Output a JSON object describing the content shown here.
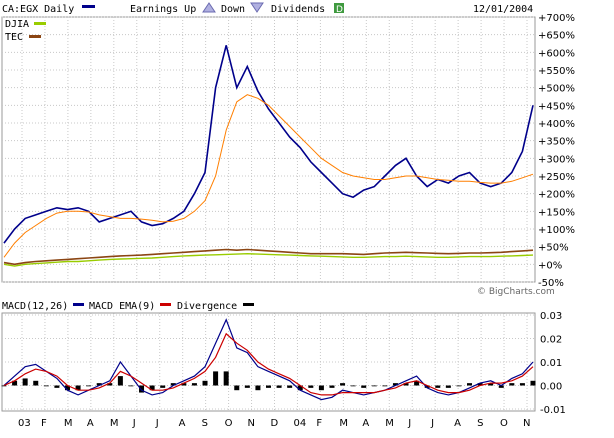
{
  "header": {
    "symbol": "CA:EGX Daily",
    "earnings_label": "Earnings Up",
    "down_label": "Down",
    "dividends_label": "Dividends",
    "dividends_marker": "D",
    "date": "12/01/2004"
  },
  "legend_price": [
    {
      "name": "DJIA",
      "color": "#99cc00"
    },
    {
      "name": "TEC",
      "color": "#8b4513"
    }
  ],
  "legend_macd": {
    "macd_label": "MACD(12,26)",
    "ema_label": "MACD EMA(9)",
    "div_label": "Divergence"
  },
  "watermark": "© BigCharts.com",
  "colors": {
    "price": "#00008b",
    "ma": "#ff7f00",
    "djia": "#99cc00",
    "tec": "#8b4513",
    "macd": "#00008b",
    "ema": "#cc0000",
    "divergence": "#000000"
  },
  "chart_data": [
    {
      "type": "line",
      "panel": "price",
      "yscale": "percent",
      "ylim": [
        -50,
        700
      ],
      "yticks": [
        "+700%",
        "+650%",
        "+600%",
        "+550%",
        "+500%",
        "+450%",
        "+400%",
        "+350%",
        "+300%",
        "+250%",
        "+200%",
        "+150%",
        "+100%",
        "+50%",
        "+0%",
        "-50%"
      ],
      "x": [
        0,
        2,
        4,
        6,
        8,
        10,
        12,
        14,
        16,
        18,
        20,
        22,
        24,
        26,
        28,
        30,
        32,
        34,
        36,
        38,
        40,
        42,
        44,
        46,
        48,
        50,
        52,
        54,
        56,
        58,
        60,
        62,
        64,
        66,
        68,
        70,
        72,
        74,
        76,
        78,
        80,
        82,
        84,
        86,
        88,
        90,
        92,
        94,
        96,
        98,
        100
      ],
      "series": [
        {
          "name": "CA:EGX",
          "values": [
            60,
            100,
            130,
            140,
            150,
            160,
            155,
            160,
            150,
            120,
            130,
            140,
            150,
            120,
            110,
            115,
            130,
            150,
            200,
            260,
            500,
            620,
            500,
            560,
            490,
            440,
            400,
            360,
            330,
            290,
            260,
            230,
            200,
            190,
            210,
            220,
            250,
            280,
            300,
            250,
            220,
            240,
            230,
            250,
            260,
            230,
            220,
            230,
            260,
            320,
            450
          ]
        },
        {
          "name": "MA",
          "values": [
            20,
            60,
            90,
            110,
            130,
            145,
            150,
            150,
            148,
            140,
            135,
            130,
            130,
            128,
            125,
            120,
            122,
            130,
            150,
            180,
            250,
            380,
            460,
            480,
            470,
            450,
            420,
            390,
            360,
            330,
            300,
            280,
            260,
            250,
            245,
            240,
            240,
            245,
            250,
            250,
            245,
            240,
            238,
            235,
            235,
            232,
            230,
            230,
            235,
            245,
            255
          ]
        },
        {
          "name": "DJIA",
          "values": [
            0,
            -5,
            0,
            2,
            4,
            6,
            8,
            8,
            10,
            12,
            14,
            15,
            16,
            17,
            18,
            20,
            22,
            24,
            25,
            26,
            27,
            28,
            29,
            30,
            29,
            28,
            27,
            26,
            25,
            24,
            23,
            22,
            21,
            20,
            20,
            21,
            22,
            22,
            23,
            22,
            21,
            20,
            20,
            21,
            22,
            22,
            22,
            23,
            24,
            25,
            26
          ]
        },
        {
          "name": "TEC",
          "values": [
            5,
            0,
            5,
            8,
            10,
            12,
            14,
            16,
            18,
            20,
            22,
            24,
            25,
            26,
            28,
            30,
            32,
            34,
            36,
            38,
            40,
            42,
            40,
            42,
            40,
            38,
            36,
            34,
            32,
            30,
            30,
            30,
            30,
            29,
            28,
            30,
            32,
            33,
            34,
            33,
            32,
            31,
            30,
            31,
            32,
            32,
            33,
            34,
            36,
            38,
            40
          ]
        }
      ],
      "xticks": [
        "03",
        "F",
        "M",
        "A",
        "M",
        "J",
        "J",
        "A",
        "S",
        "O",
        "N",
        "D",
        "04",
        "F",
        "M",
        "A",
        "M",
        "J",
        "J",
        "A",
        "S",
        "O",
        "N"
      ]
    },
    {
      "type": "line",
      "panel": "macd",
      "ylim": [
        -0.01,
        0.03
      ],
      "yticks": [
        "0.03",
        "0.02",
        "0.01",
        "0.00",
        "-0.01"
      ],
      "x": [
        0,
        2,
        4,
        6,
        8,
        10,
        12,
        14,
        16,
        18,
        20,
        22,
        24,
        26,
        28,
        30,
        32,
        34,
        36,
        38,
        40,
        42,
        44,
        46,
        48,
        50,
        52,
        54,
        56,
        58,
        60,
        62,
        64,
        66,
        68,
        70,
        72,
        74,
        76,
        78,
        80,
        82,
        84,
        86,
        88,
        90,
        92,
        94,
        96,
        98,
        100
      ],
      "series": [
        {
          "name": "MACD",
          "values": [
            0.0,
            0.004,
            0.008,
            0.009,
            0.006,
            0.003,
            -0.002,
            -0.004,
            -0.002,
            0.0,
            0.002,
            0.01,
            0.004,
            -0.002,
            -0.004,
            -0.003,
            0.0,
            0.002,
            0.004,
            0.008,
            0.018,
            0.028,
            0.016,
            0.014,
            0.008,
            0.006,
            0.004,
            0.002,
            -0.002,
            -0.004,
            -0.006,
            -0.005,
            -0.002,
            -0.003,
            -0.004,
            -0.003,
            -0.002,
            0.0,
            0.002,
            0.004,
            -0.001,
            -0.003,
            -0.004,
            -0.003,
            -0.001,
            0.001,
            0.002,
            0.0,
            0.003,
            0.005,
            0.01
          ]
        },
        {
          "name": "EMA",
          "values": [
            0.0,
            0.002,
            0.005,
            0.007,
            0.006,
            0.004,
            0.0,
            -0.002,
            -0.002,
            -0.001,
            0.001,
            0.006,
            0.004,
            0.001,
            -0.002,
            -0.002,
            -0.001,
            0.001,
            0.003,
            0.006,
            0.012,
            0.022,
            0.018,
            0.015,
            0.01,
            0.007,
            0.005,
            0.003,
            0.0,
            -0.003,
            -0.004,
            -0.004,
            -0.003,
            -0.003,
            -0.003,
            -0.003,
            -0.002,
            -0.001,
            0.001,
            0.002,
            0.0,
            -0.002,
            -0.003,
            -0.003,
            -0.002,
            0.0,
            0.001,
            0.001,
            0.002,
            0.004,
            0.008
          ]
        },
        {
          "name": "Divergence",
          "values": [
            0.0,
            0.002,
            0.003,
            0.002,
            0.0,
            -0.001,
            -0.002,
            -0.002,
            0.0,
            0.001,
            0.001,
            0.004,
            0.0,
            -0.003,
            -0.002,
            -0.001,
            0.001,
            0.001,
            0.001,
            0.002,
            0.006,
            0.006,
            -0.002,
            -0.001,
            -0.002,
            -0.001,
            -0.001,
            -0.001,
            -0.002,
            -0.001,
            -0.002,
            -0.001,
            0.001,
            0.0,
            -0.001,
            0.0,
            0.0,
            0.001,
            0.001,
            0.002,
            -0.001,
            -0.001,
            -0.001,
            0.0,
            0.001,
            0.001,
            0.001,
            -0.001,
            0.001,
            0.001,
            0.002
          ]
        }
      ]
    }
  ]
}
